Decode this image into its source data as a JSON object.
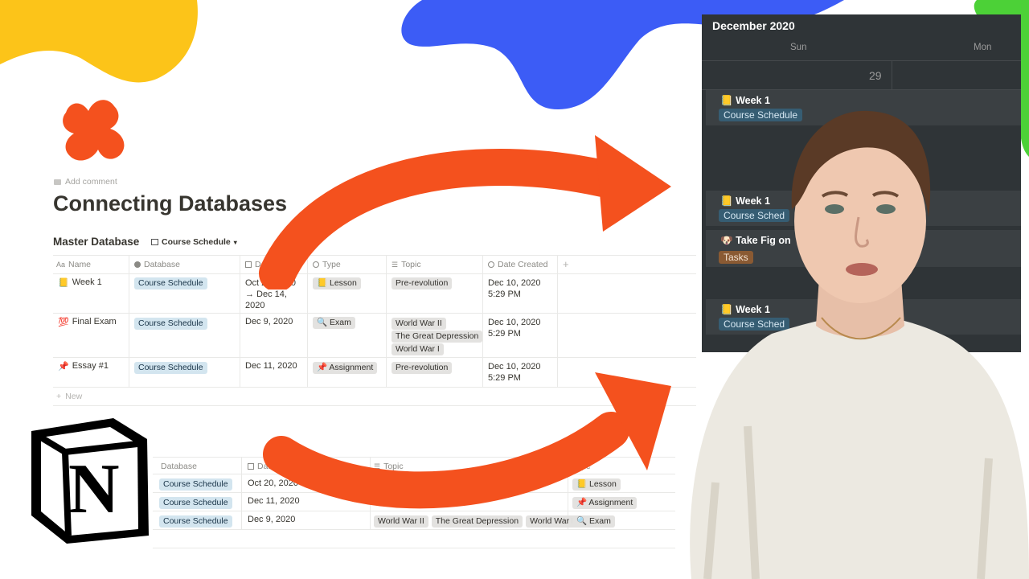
{
  "page": {
    "add_comment": "Add comment",
    "title": "Connecting Databases"
  },
  "master_db": {
    "name": "Master Database",
    "view_name": "Course Schedule",
    "columns": [
      "Name",
      "Database",
      "Date",
      "Type",
      "Topic",
      "Date Created"
    ],
    "rows": [
      {
        "icon": "📒",
        "name": "Week 1",
        "database": "Course Schedule",
        "date": [
          "Oct 20, 2020",
          "→ Dec 14,",
          "2020"
        ],
        "type_icon": "📒",
        "type": "Lesson",
        "topics": [
          "Pre-revolution"
        ],
        "created": [
          "Dec 10, 2020",
          "5:29 PM"
        ]
      },
      {
        "icon": "💯",
        "name": "Final Exam",
        "database": "Course Schedule",
        "date": [
          "Dec 9, 2020"
        ],
        "type_icon": "🔍",
        "type": "Exam",
        "topics": [
          "World War II",
          "The Great Depression",
          "World War I"
        ],
        "created": [
          "Dec 10, 2020",
          "5:29 PM"
        ]
      },
      {
        "icon": "📌",
        "name": "Essay #1",
        "database": "Course Schedule",
        "date": [
          "Dec 11, 2020"
        ],
        "type_icon": "📌",
        "type": "Assignment",
        "topics": [
          "Pre-revolution"
        ],
        "created": [
          "Dec 10, 2020",
          "5:29 PM"
        ]
      }
    ],
    "new_label": "New"
  },
  "second_db": {
    "columns": [
      "Database",
      "Date",
      "Topic",
      "Type"
    ],
    "rows": [
      {
        "database": "Course Schedule",
        "date": "Oct 20, 2020",
        "topics": [],
        "type_icon": "📒",
        "type": "Lesson"
      },
      {
        "database": "Course Schedule",
        "date": "Dec 11, 2020",
        "topics": [],
        "type_icon": "📌",
        "type": "Assignment"
      },
      {
        "database": "Course Schedule",
        "date": "Dec 9, 2020",
        "topics": [
          "World War II",
          "The Great Depression",
          "World War I"
        ],
        "type_icon": "🔍",
        "type": "Exam"
      }
    ]
  },
  "calendar": {
    "month": "December 2020",
    "days": [
      "Sun",
      "Mon"
    ],
    "date_number": "29",
    "cards": [
      {
        "icon": "📒",
        "name": "Week 1",
        "tag": "Course Schedule",
        "tag_color": "blue"
      },
      {
        "icon": "📒",
        "name": "Week 1",
        "tag": "Course Sched",
        "tag_color": "blue"
      },
      {
        "icon": "🐶",
        "name": "Take Fig on",
        "tag": "Tasks",
        "tag_color": "orange"
      },
      {
        "icon": "📒",
        "name": "Week 1",
        "tag": "Course Sched",
        "tag_color": "blue"
      }
    ]
  },
  "logo": {
    "letter": "N"
  },
  "colors": {
    "yellow_blob": "#fcc419",
    "blue_blob": "#3c5cf6",
    "orange_arrow": "#f4511e",
    "green_blob": "#4cd137"
  }
}
